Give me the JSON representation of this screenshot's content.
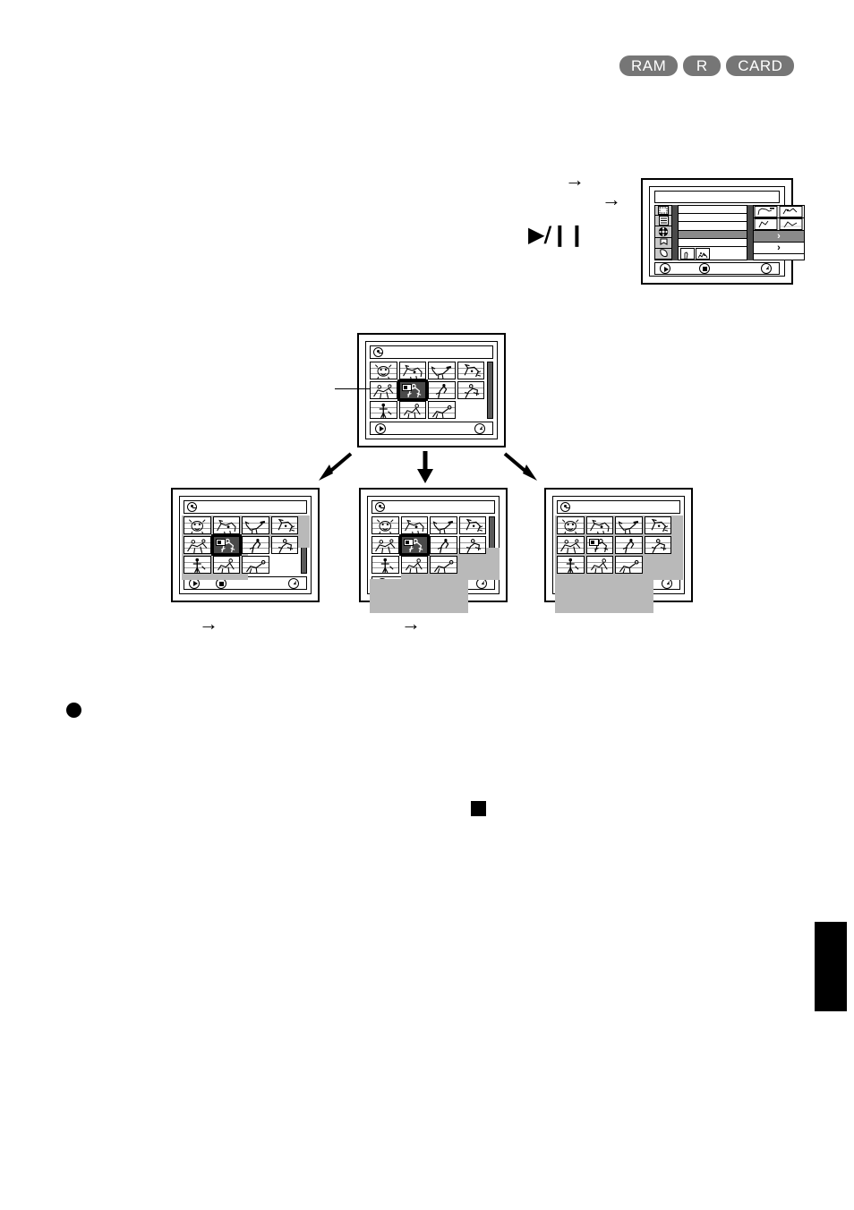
{
  "page": {
    "media_badges": [
      {
        "label": "RAM",
        "name": "badge-ram"
      },
      {
        "label": "R",
        "name": "badge-r"
      },
      {
        "label": "CARD",
        "name": "badge-card"
      }
    ],
    "symbols": {
      "arrow_right": "→",
      "play_pause": "▶/❙❙",
      "chevron_right": "›",
      "bullet": "●",
      "stop_square": "■"
    },
    "inline_arrows": [
      {
        "name": "inline-arrow-1",
        "glyph": "→"
      },
      {
        "name": "inline-arrow-2",
        "glyph": "→"
      },
      {
        "name": "inline-arrow-3",
        "glyph": "→"
      },
      {
        "name": "inline-arrow-4",
        "glyph": "→"
      }
    ],
    "play_pause_label": "▶/❙❙"
  },
  "menu_screen": {
    "name": "lcd-menu-screen",
    "icon_column": [
      {
        "name": "menu-icon-disc-format"
      },
      {
        "name": "menu-icon-list"
      },
      {
        "name": "menu-icon-film-reel"
      },
      {
        "name": "menu-icon-flag"
      },
      {
        "name": "menu-icon-tag"
      }
    ],
    "rows": [
      {
        "name": "menu-row-1",
        "highlighted": false,
        "chevron": ""
      },
      {
        "name": "menu-row-2",
        "highlighted": false,
        "chevron": ""
      },
      {
        "name": "menu-row-3",
        "highlighted": false,
        "chevron": ""
      },
      {
        "name": "menu-row-4",
        "highlighted": true,
        "chevron": "›"
      },
      {
        "name": "menu-row-5",
        "highlighted": false,
        "chevron": "›"
      },
      {
        "name": "menu-row-6",
        "highlighted": false,
        "chevron": ""
      }
    ],
    "bottom_bar": [
      {
        "name": "lcd-play-button",
        "icon": "play-icon"
      },
      {
        "name": "lcd-stop-button",
        "icon": "stop-icon"
      },
      {
        "name": "lcd-clock-indicator",
        "icon": "clock-icon"
      }
    ]
  },
  "screens": [
    {
      "name": "lcd-thumbnail-screen-main",
      "title_icon": "disc-select-icon",
      "selected_index": 5,
      "selection_mode": "single",
      "thumb_count": 11,
      "highlight_ranges": [],
      "bottom_bar": [
        {
          "name": "lcd-play-button",
          "icon": "play-icon"
        },
        {
          "name": "lcd-clock-indicator",
          "icon": "clock-icon"
        }
      ]
    },
    {
      "name": "lcd-thumbnail-screen-select-preceding",
      "title_icon": "disc-select-icon",
      "selected_index": 5,
      "selection_mode": "preceding",
      "thumb_count": 11,
      "highlight_ranges": [
        [
          0,
          5
        ]
      ],
      "bottom_bar": [
        {
          "name": "lcd-play-button",
          "icon": "play-icon"
        },
        {
          "name": "lcd-stop-button",
          "icon": "stop-icon"
        },
        {
          "name": "lcd-clock-indicator",
          "icon": "clock-icon"
        }
      ]
    },
    {
      "name": "lcd-thumbnail-screen-select-following",
      "title_icon": "disc-select-icon",
      "selected_index": 5,
      "selection_mode": "following",
      "thumb_count": 11,
      "highlight_ranges": [
        [
          5,
          10
        ]
      ],
      "bottom_bar": [
        {
          "name": "lcd-play-button",
          "icon": "play-icon"
        },
        {
          "name": "lcd-stop-button",
          "icon": "stop-icon"
        },
        {
          "name": "lcd-clock-indicator",
          "icon": "clock-icon"
        }
      ]
    },
    {
      "name": "lcd-thumbnail-screen-select-all",
      "title_icon": "disc-select-icon",
      "selected_index": 5,
      "selection_mode": "all",
      "thumb_count": 11,
      "highlight_ranges": [
        [
          0,
          10
        ]
      ],
      "bottom_bar": [
        {
          "name": "lcd-play-button",
          "icon": "play-icon"
        },
        {
          "name": "lcd-stop-button",
          "icon": "stop-icon"
        },
        {
          "name": "lcd-clock-indicator",
          "icon": "clock-icon"
        }
      ]
    }
  ],
  "flow_arrows": [
    {
      "name": "flow-arrow-down-left",
      "direction": "down-left"
    },
    {
      "name": "flow-arrow-down",
      "direction": "down"
    },
    {
      "name": "flow-arrow-down-right",
      "direction": "down-right"
    }
  ],
  "page_marker": {
    "name": "page-edge-tab"
  }
}
